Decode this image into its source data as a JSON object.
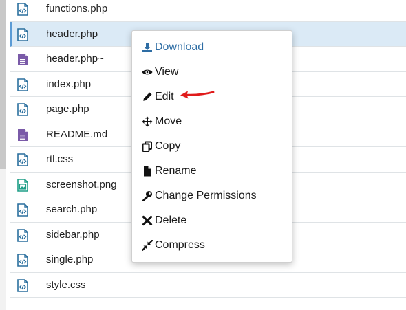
{
  "files": [
    {
      "name": "functions.php",
      "type": "code",
      "selected": false
    },
    {
      "name": "header.php",
      "type": "code",
      "selected": true
    },
    {
      "name": "header.php~",
      "type": "text",
      "selected": false
    },
    {
      "name": "index.php",
      "type": "code",
      "selected": false
    },
    {
      "name": "page.php",
      "type": "code",
      "selected": false
    },
    {
      "name": "README.md",
      "type": "text",
      "selected": false
    },
    {
      "name": "rtl.css",
      "type": "code",
      "selected": false
    },
    {
      "name": "screenshot.png",
      "type": "image",
      "selected": false
    },
    {
      "name": "search.php",
      "type": "code",
      "selected": false
    },
    {
      "name": "sidebar.php",
      "type": "code",
      "selected": false
    },
    {
      "name": "single.php",
      "type": "code",
      "selected": false
    },
    {
      "name": "style.css",
      "type": "code",
      "selected": false
    }
  ],
  "context_menu": {
    "download": "Download",
    "view": "View",
    "edit": "Edit",
    "move": "Move",
    "copy": "Copy",
    "rename": "Rename",
    "change_permissions": "Change Permissions",
    "delete": "Delete",
    "compress": "Compress"
  },
  "icons": {
    "download": "download-icon",
    "view": "eye-icon",
    "edit": "pencil-icon",
    "move": "move-arrows-icon",
    "copy": "copy-icon",
    "rename": "file-icon",
    "change_permissions": "key-icon",
    "delete": "x-icon",
    "compress": "compress-icon"
  },
  "colors": {
    "code_icon": "#2a6f9e",
    "text_icon": "#7a5aa8",
    "image_icon": "#1e9e87",
    "selected_row": "#dbeaf6",
    "selected_border": "#5b9bd5",
    "download_link": "#2e6da4",
    "annotation_arrow": "#e01b1b"
  }
}
